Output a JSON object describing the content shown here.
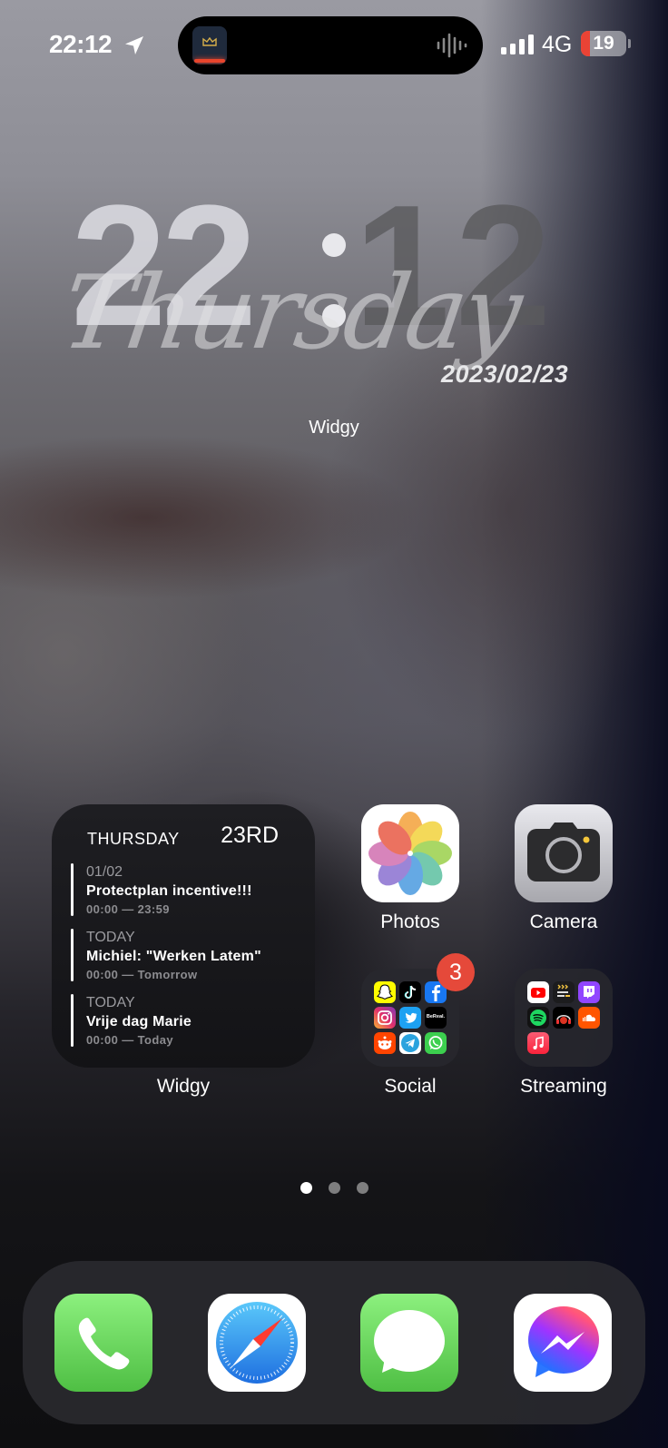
{
  "status_bar": {
    "time": "22:12",
    "location_icon": "location-arrow-icon",
    "network": "4G",
    "battery_percent": 19,
    "battery_text": "19",
    "battery_low_color": "#ea4335",
    "dynamic_island": {
      "app_icon": "crown-app-icon",
      "activity_icon": "waveform-icon",
      "progress_color": "#e8452c"
    }
  },
  "clock_widget": {
    "hours": "22",
    "minutes": "12",
    "day_script": "Thursday",
    "date": "2023/02/23",
    "label": "Widgy"
  },
  "calendar_widget": {
    "day": "THURSDAY",
    "date": "23RD",
    "label": "Widgy",
    "events": [
      {
        "when": "01/02",
        "title": "Protectplan incentive!!!",
        "time": "00:00 — 23:59"
      },
      {
        "when": "TODAY",
        "title": "Michiel: \"Werken Latem\"",
        "time": "00:00 — Tomorrow"
      },
      {
        "when": "TODAY",
        "title": "Vrije dag Marie",
        "time": "00:00 — Today"
      }
    ]
  },
  "apps": [
    {
      "name": "Photos",
      "icon": "photos-icon"
    },
    {
      "name": "Camera",
      "icon": "camera-icon"
    },
    {
      "name": "Social",
      "icon": "folder-icon",
      "badge": "3",
      "contents": [
        "Snapchat",
        "TikTok",
        "Facebook",
        "Instagram",
        "Twitter",
        "BeReal",
        "Reddit",
        "Telegram",
        "WhatsApp"
      ],
      "bereal_text": "BeReal."
    },
    {
      "name": "Streaming",
      "icon": "folder-icon",
      "contents": [
        "YouTube",
        "MovieBox",
        "Twitch",
        "Spotify",
        "Music Player",
        "SoundCloud",
        "Apple Music"
      ]
    }
  ],
  "page_indicator": {
    "pages": 3,
    "current": 1
  },
  "dock": [
    {
      "name": "Phone",
      "icon": "phone-icon"
    },
    {
      "name": "Safari",
      "icon": "safari-icon"
    },
    {
      "name": "Messages",
      "icon": "messages-icon"
    },
    {
      "name": "Messenger",
      "icon": "messenger-icon"
    }
  ]
}
